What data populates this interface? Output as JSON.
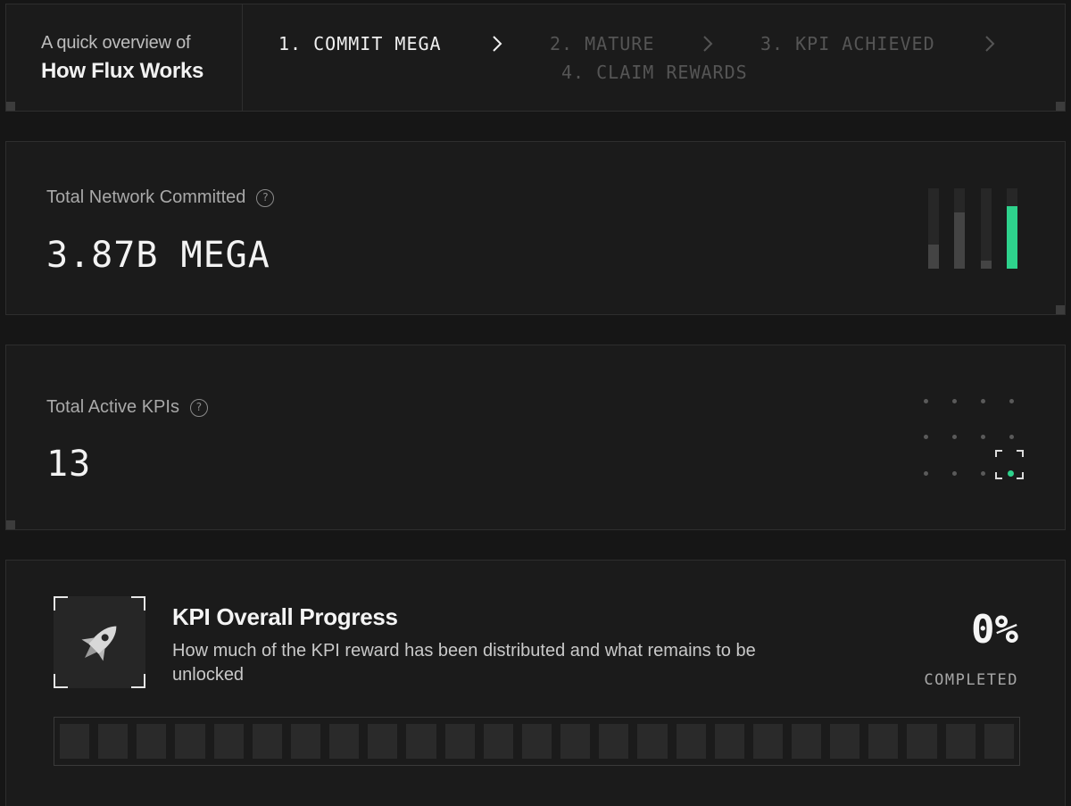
{
  "header": {
    "subtitle": "A quick overview of",
    "title": "How Flux Works",
    "steps": [
      {
        "label": "1. COMMIT MEGA",
        "active": true
      },
      {
        "label": "2. MATURE",
        "active": false
      },
      {
        "label": "3. KPI ACHIEVED",
        "active": false
      },
      {
        "label": "4. CLAIM REWARDS",
        "active": false
      }
    ],
    "chevron_icon": "chevron-right-icon"
  },
  "committed": {
    "label": "Total Network Committed",
    "value": "3.87B MEGA",
    "help_icon": "question-circle-icon",
    "bar_levels": [
      0.3,
      0.7,
      0.1,
      0.78
    ]
  },
  "active_kpis": {
    "label": "Total Active KPIs",
    "value": "13",
    "help_icon": "question-circle-icon"
  },
  "progress": {
    "title": "KPI Overall Progress",
    "description": "How much of the KPI reward has been distributed and what remains to be unlocked",
    "percent": "0%",
    "completed_label": "COMPLETED",
    "segment_count": 25,
    "filled_segments": 0,
    "icon": "rocket-icon"
  },
  "colors": {
    "accent": "#2ed28c",
    "background": "#161616",
    "card": "#1b1b1b"
  }
}
